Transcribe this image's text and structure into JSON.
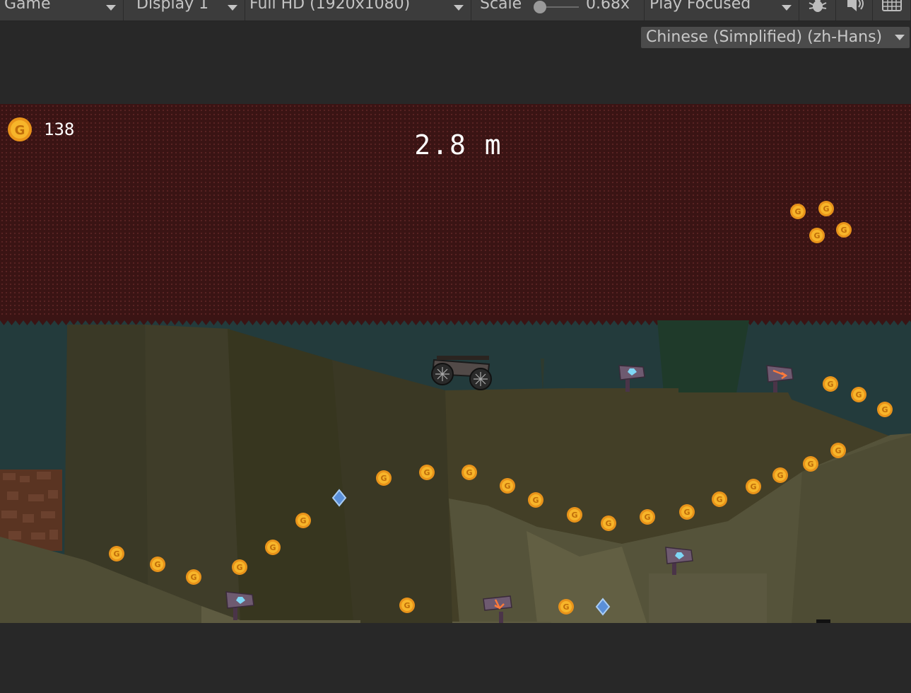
{
  "toolbar": {
    "view_mode": "Game",
    "display": "Display 1",
    "resolution": "Full HD (1920x1080)",
    "scale_label": "Scale",
    "scale_value": "0.68x",
    "play_mode": "Play Focused",
    "icons": [
      "bug-icon",
      "audio-icon",
      "keyboard-icon"
    ]
  },
  "locale_selector": {
    "value": "Chinese (Simplified) (zh-Hans)"
  },
  "hud": {
    "coin_count": "138",
    "distance": "2.8 m"
  },
  "colors": {
    "editor_bg": "#282828",
    "toolbar_bg": "#3c3c3c",
    "ceiling": "#3a1414",
    "cave_bg": "#233b3c",
    "ground": "#4a4631",
    "coin": "#f2a51c",
    "gem": "#5a8fd8"
  }
}
